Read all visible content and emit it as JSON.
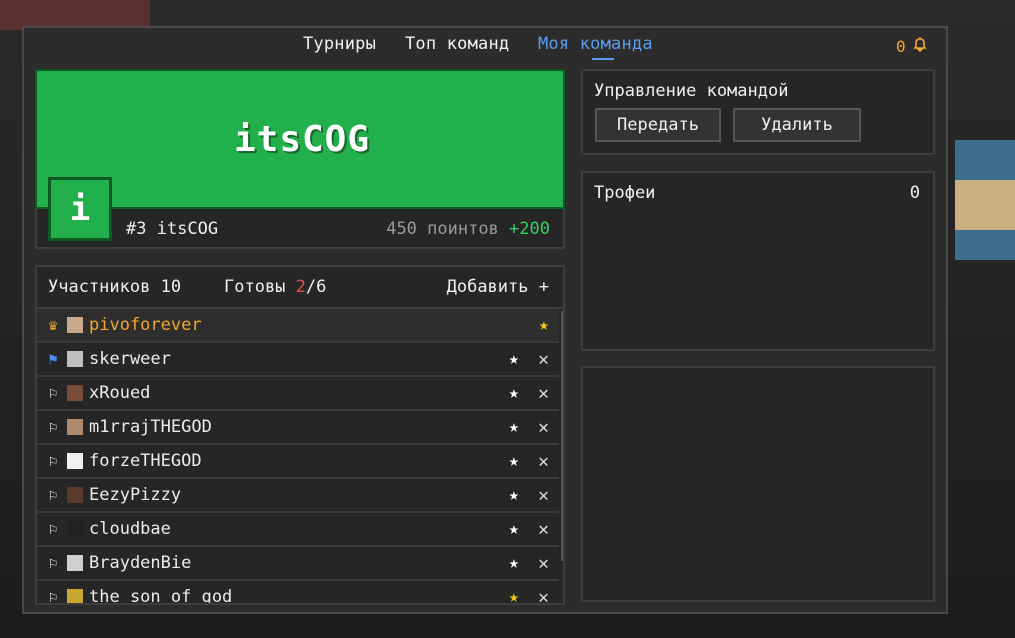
{
  "nav": {
    "items": [
      {
        "label": "Турниры"
      },
      {
        "label": "Топ команд"
      },
      {
        "label": "Моя команда",
        "active": true
      }
    ],
    "notifications_count": "0"
  },
  "team": {
    "name": "itsCOG",
    "avatar_letter": "i",
    "rank_label": "#3 itsCOG",
    "points_label": "450 поинтов",
    "points_delta": "+200",
    "accent_color": "#21b04b"
  },
  "members": {
    "count_label": "Участников 10",
    "ready_prefix": "Готовы ",
    "ready_value": "2",
    "ready_total": "/6",
    "add_label": "Добавить",
    "rows": [
      {
        "name": "pivoforever",
        "role": "owner",
        "flag": "crown-icon",
        "starred": true,
        "kickable": false
      },
      {
        "name": "skerweer",
        "role": "member",
        "flag": "blue-flag-icon",
        "starred": false,
        "kickable": true
      },
      {
        "name": "xRoued",
        "role": "member",
        "flag": "flag-icon",
        "starred": false,
        "kickable": true
      },
      {
        "name": "m1rrajTHEGOD",
        "role": "member",
        "flag": "flag-icon",
        "starred": false,
        "kickable": true
      },
      {
        "name": "forzeTHEGOD",
        "role": "member",
        "flag": "flag-icon",
        "starred": false,
        "kickable": true
      },
      {
        "name": "EezyPizzy",
        "role": "member",
        "flag": "flag-icon",
        "starred": false,
        "kickable": true
      },
      {
        "name": "cloudbae",
        "role": "member",
        "flag": "flag-icon",
        "starred": false,
        "kickable": true
      },
      {
        "name": "BraydenBie",
        "role": "member",
        "flag": "flag-icon",
        "starred": false,
        "kickable": true
      },
      {
        "name": "the son of god",
        "role": "member",
        "flag": "flag-icon",
        "starred": true,
        "kickable": true
      }
    ]
  },
  "manage": {
    "title": "Управление командой",
    "transfer_label": "Передать",
    "delete_label": "Удалить"
  },
  "trophies": {
    "title": "Трофеи",
    "count": "0"
  },
  "colors": {
    "active_tab": "#5b9cf0",
    "gold": "#f0a830",
    "positive": "#37d067",
    "ready": "#e64b4b"
  }
}
